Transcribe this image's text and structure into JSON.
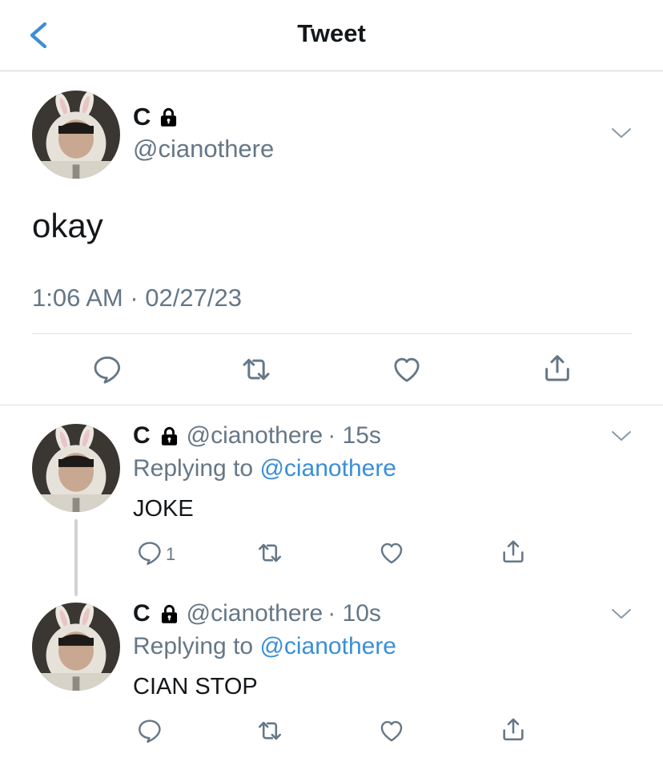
{
  "header": {
    "title": "Tweet"
  },
  "main_tweet": {
    "name": "C",
    "handle": "@cianothere",
    "text": "okay",
    "timestamp": "1:06 AM · 02/27/23"
  },
  "replies": [
    {
      "name": "C",
      "handle": "@cianothere",
      "time": "· 15s",
      "replying_prefix": "Replying to ",
      "replying_to": "@cianothere",
      "text": "JOKE",
      "reply_count": "1"
    },
    {
      "name": "C",
      "handle": "@cianothere",
      "time": "· 10s",
      "replying_prefix": "Replying to ",
      "replying_to": "@cianothere",
      "text": "CIAN STOP",
      "reply_count": ""
    }
  ],
  "colors": {
    "accent": "#3b8ed6",
    "secondary_text": "#657786",
    "primary_text": "#14171a",
    "divider": "#dfe2e5"
  },
  "icons": [
    "back-chevron-icon",
    "lock-icon",
    "chevron-down-icon",
    "reply-icon",
    "retweet-icon",
    "like-icon",
    "share-icon"
  ]
}
